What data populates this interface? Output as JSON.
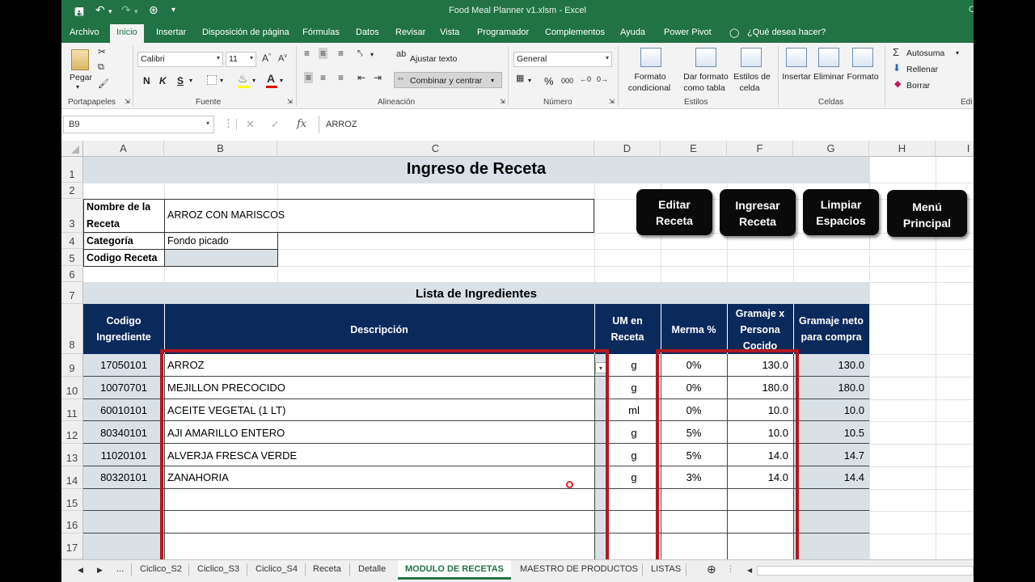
{
  "window": {
    "title": "Food Meal Planner v1.xlsm  -  Excel",
    "corner": "C"
  },
  "quick_access": [
    "save-icon",
    "undo-icon",
    "redo-icon",
    "touch-mode-icon",
    "customize-icon"
  ],
  "tabs": [
    "Archivo",
    "Inicio",
    "Insertar",
    "Disposición de página",
    "Fórmulas",
    "Datos",
    "Revisar",
    "Vista",
    "Programador",
    "Complementos",
    "Ayuda",
    "Power Pivot"
  ],
  "tell_me": "¿Qué desea hacer?",
  "ribbon": {
    "clipboard": {
      "paste": "Pegar",
      "label": "Portapapeles"
    },
    "font": {
      "name": "Calibri",
      "size": "11",
      "bold": "N",
      "italic": "K",
      "underline": "S",
      "label": "Fuente"
    },
    "alignment": {
      "wrap": "Ajustar texto",
      "merge": "Combinar y centrar",
      "label": "Alineación"
    },
    "number": {
      "format": "General",
      "percent": "%",
      "thousands": "000",
      "label": "Número"
    },
    "styles": {
      "cond1": "Formato",
      "cond2": "condicional",
      "table1": "Dar formato",
      "table2": "como tabla",
      "cell1": "Estilos de",
      "cell2": "celda",
      "label": "Estilos"
    },
    "cells": {
      "insert": "Insertar",
      "delete": "Eliminar",
      "format": "Formato",
      "label": "Celdas"
    },
    "editing": {
      "autosum": "Autosuma",
      "fill": "Rellenar",
      "clear": "Borrar",
      "label": "Edi"
    }
  },
  "formula_bar": {
    "cell_ref": "B9",
    "value": "ARROZ"
  },
  "columns": [
    "A",
    "B",
    "C",
    "D",
    "E",
    "F",
    "G",
    "H",
    "I"
  ],
  "rows": [
    "1",
    "2",
    "3",
    "4",
    "5",
    "6",
    "7",
    "8",
    "9",
    "10",
    "11",
    "12",
    "13",
    "14",
    "15",
    "16",
    "17"
  ],
  "sheet": {
    "title": "Ingreso de Receta",
    "labels": {
      "name_1": "Nombre de la",
      "name_2": "Receta",
      "category": "Categoría",
      "code": "Codigo Receta"
    },
    "values": {
      "name": "ARROZ CON MARISCOS",
      "category": "Fondo picado",
      "code": ""
    },
    "buttons": [
      {
        "l1": "Editar",
        "l2": "Receta"
      },
      {
        "l1": "Ingresar",
        "l2": "Receta"
      },
      {
        "l1": "Limpiar",
        "l2": "Espacios"
      },
      {
        "l1": "Menú",
        "l2": "Principal"
      }
    ],
    "list_title": "Lista de Ingredientes",
    "headers": {
      "code_1": "Codigo",
      "code_2": "Ingrediente",
      "desc": "Descripción",
      "um_1": "UM en",
      "um_2": "Receta",
      "merma": "Merma %",
      "gram_1": "Gramaje x",
      "gram_2": "Persona",
      "gram_3": "Cocido",
      "net_1": "Gramaje neto",
      "net_2": "para compra"
    },
    "ingredients": [
      {
        "code": "17050101",
        "desc": "ARROZ",
        "um": "g",
        "merma": "0%",
        "gramaje": "130.0",
        "neto": "130.0"
      },
      {
        "code": "10070701",
        "desc": "MEJILLON PRECOCIDO",
        "um": "g",
        "merma": "0%",
        "gramaje": "180.0",
        "neto": "180.0"
      },
      {
        "code": "60010101",
        "desc": "ACEITE VEGETAL (1 LT)",
        "um": "ml",
        "merma": "0%",
        "gramaje": "10.0",
        "neto": "10.0"
      },
      {
        "code": "80340101",
        "desc": "AJI AMARILLO ENTERO",
        "um": "g",
        "merma": "5%",
        "gramaje": "10.0",
        "neto": "10.5"
      },
      {
        "code": "11020101",
        "desc": "ALVERJA FRESCA VERDE",
        "um": "g",
        "merma": "5%",
        "gramaje": "14.0",
        "neto": "14.7"
      },
      {
        "code": "80320101",
        "desc": "ZANAHORIA",
        "um": "g",
        "merma": "3%",
        "gramaje": "14.0",
        "neto": "14.4"
      }
    ]
  },
  "sheet_tabs": [
    "...",
    "Ciclico_S2",
    "Ciclico_S3",
    "Ciclico_S4",
    "Receta",
    "Detalle",
    "MODULO DE RECETAS",
    "MAESTRO DE PRODUCTOS",
    "LISTAS"
  ],
  "colors": {
    "excel_green": "#217346",
    "navy": "#0b2a5c",
    "gray_fill": "#d9e1e7",
    "red_box": "#b01920"
  }
}
